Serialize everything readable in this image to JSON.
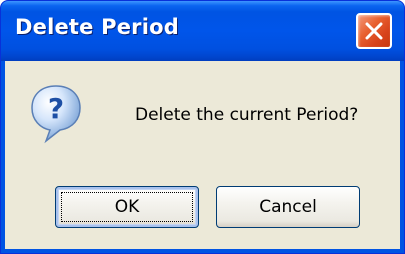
{
  "window": {
    "title": "Delete Period",
    "close_icon": "close-icon"
  },
  "dialog": {
    "icon": "question-icon",
    "message": "Delete the current Period?"
  },
  "buttons": {
    "ok_label": "OK",
    "cancel_label": "Cancel"
  },
  "colors": {
    "titlebar": "#0054e3",
    "close_button": "#e0592a",
    "client_background": "#ece9d8"
  }
}
